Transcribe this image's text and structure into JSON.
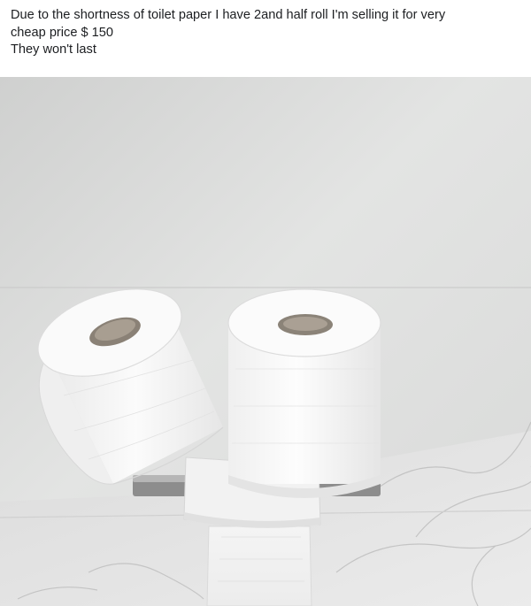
{
  "post": {
    "text_lines": [
      "Due to the shortness of toilet paper I have 2and half roll I'm selling it for very",
      "cheap price $ 150",
      "They won't last"
    ]
  },
  "photo": {
    "subject": "toilet-paper-rolls",
    "colors": {
      "wall": "#d9d9d9",
      "marble": "#e4e4e4",
      "paper": "#f7f7f7"
    }
  }
}
